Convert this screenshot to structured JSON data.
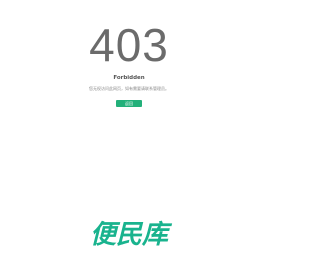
{
  "error": {
    "code": "403",
    "title": "Forbidden",
    "description": "您无权访问此网页，如有需要请联系管理员。"
  },
  "actions": {
    "back_label": "返回"
  },
  "brand": {
    "name": "便民库"
  },
  "colors": {
    "accent": "#23b07a",
    "brand": "#19b38e",
    "code_text": "#6b6b6b"
  }
}
